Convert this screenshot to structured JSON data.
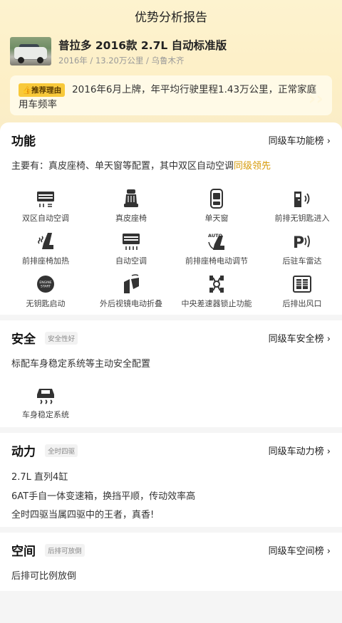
{
  "header": {
    "title": "优势分析报告"
  },
  "car": {
    "name": "普拉多 2016款 2.7L 自动标准版",
    "meta": "2016年 / 13.20万公里 / 乌鲁木齐"
  },
  "reason": {
    "tag": "推荐理由",
    "text": "2016年6月上牌，年平均行驶里程1.43万公里，正常家庭用车频率"
  },
  "function": {
    "title": "功能",
    "link": "同级车功能榜 ›",
    "desc_prefix": "主要有：真皮座椅、单天窗等配置，其中双区自动空调",
    "desc_highlight": "同级领先",
    "features": [
      {
        "label": "双区自动空调",
        "icon": "dual-zone-ac-icon"
      },
      {
        "label": "真皮座椅",
        "icon": "leather-seat-icon"
      },
      {
        "label": "单天窗",
        "icon": "sunroof-icon"
      },
      {
        "label": "前排无钥匙进入",
        "icon": "keyless-entry-icon"
      },
      {
        "label": "前排座椅加热",
        "icon": "seat-heating-icon"
      },
      {
        "label": "自动空调",
        "icon": "auto-ac-icon"
      },
      {
        "label": "前排座椅电动调节",
        "icon": "power-seat-icon"
      },
      {
        "label": "后驻车雷达",
        "icon": "parking-radar-icon"
      },
      {
        "label": "无钥匙启动",
        "icon": "start-button-icon"
      },
      {
        "label": "外后视镜电动折叠",
        "icon": "mirror-fold-icon"
      },
      {
        "label": "中央差速器锁止功能",
        "icon": "diff-lock-icon"
      },
      {
        "label": "后排出风口",
        "icon": "rear-vent-icon"
      }
    ]
  },
  "safety": {
    "title": "安全",
    "tag": "安全性好",
    "link": "同级车安全榜 ›",
    "desc": "标配车身稳定系统等主动安全配置",
    "features": [
      {
        "label": "车身稳定系统",
        "icon": "esp-icon"
      }
    ]
  },
  "power": {
    "title": "动力",
    "tag": "全时四驱",
    "link": "同级车动力榜 ›",
    "lines": [
      "2.7L 直列4缸",
      "6AT手自一体变速箱，换挡平顺，传动效率高",
      "全时四驱当属四驱中的王者，真香!"
    ]
  },
  "space": {
    "title": "空间",
    "tag": "后排可放倒",
    "link": "同级车空间榜 ›",
    "desc": "后排可比例放倒"
  },
  "colors": {
    "accent": "#d69a0a",
    "tag_yellow": "#f8c93a",
    "hero_bg": "#fdf3cf"
  }
}
